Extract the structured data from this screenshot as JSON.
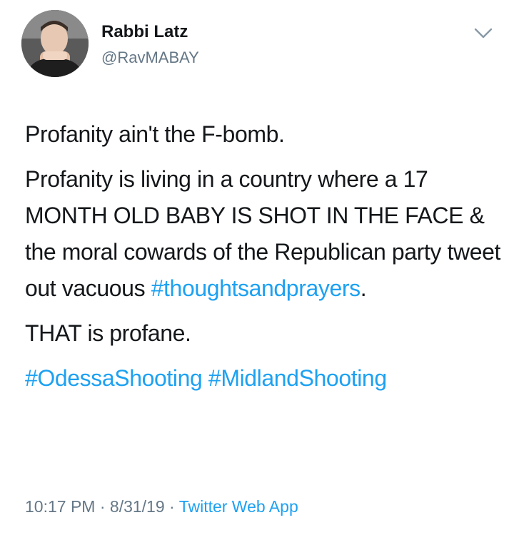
{
  "user": {
    "display_name": "Rabbi Latz",
    "handle": "@RavMABAY"
  },
  "tweet": {
    "paragraph1": "Profanity ain't the F-bomb.",
    "paragraph2_text": "Profanity is living in a country where a 17 MONTH OLD BABY IS SHOT IN THE FACE & the moral cowards of the Republican party tweet out vacuous ",
    "paragraph2_hashtag": "#thoughtsandprayers",
    "paragraph2_end": ".",
    "paragraph3": "THAT is profane.",
    "hashtag1": "#OdessaShooting",
    "hashtag2": "#MidlandShooting"
  },
  "meta": {
    "time": "10:17 PM",
    "separator1": " · ",
    "date": "8/31/19",
    "separator2": " · ",
    "source": "Twitter Web App"
  },
  "icons": {
    "avatar": "avatar",
    "caret": "chevron-down-icon"
  },
  "colors": {
    "link": "#1da1f2",
    "text": "#14171a",
    "muted": "#657786"
  }
}
